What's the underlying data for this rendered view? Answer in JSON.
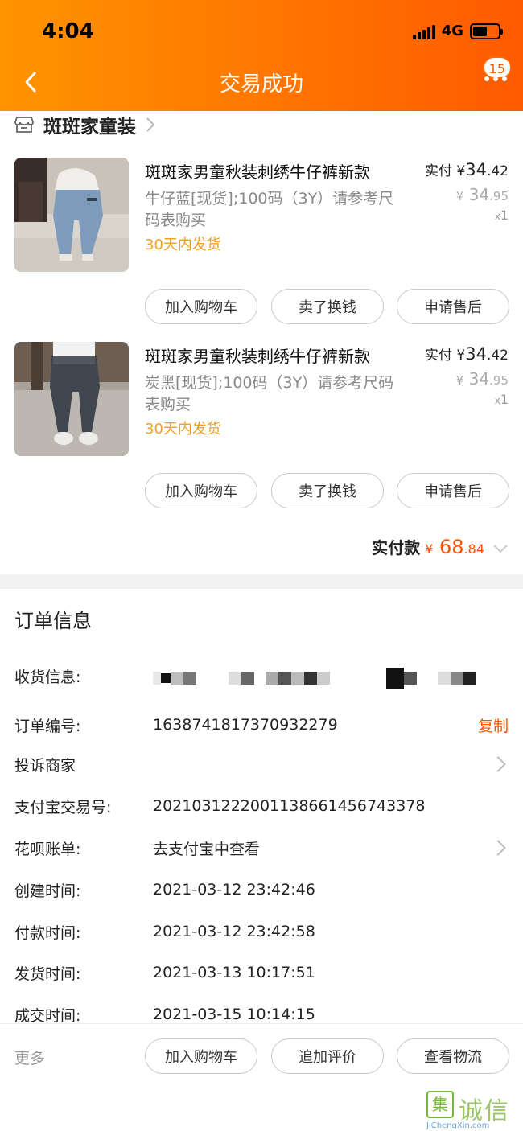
{
  "status_bar": {
    "time": "4:04",
    "network": "4G"
  },
  "nav": {
    "title": "交易成功",
    "badge": "15"
  },
  "shop": {
    "name": "斑斑家童装"
  },
  "products": [
    {
      "title": "斑斑家男童秋装刺绣牛仔裤新款",
      "spec": "牛仔蓝[现货];100码（3Y）请参考尺码表购买",
      "ship": "30天内发货",
      "paid_label": "实付",
      "paid_currency": "¥",
      "paid_int": "34",
      "paid_dec": ".42",
      "orig_currency": "¥",
      "orig_int": "34",
      "orig_dec": ".95",
      "qty_prefix": "x",
      "qty": "1",
      "buttons": [
        "加入购物车",
        "卖了换钱",
        "申请售后"
      ]
    },
    {
      "title": "斑斑家男童秋装刺绣牛仔裤新款",
      "spec": "炭黑[现货];100码（3Y）请参考尺码表购买",
      "ship": "30天内发货",
      "paid_label": "实付",
      "paid_currency": "¥",
      "paid_int": "34",
      "paid_dec": ".42",
      "orig_currency": "¥",
      "orig_int": "34",
      "orig_dec": ".95",
      "qty_prefix": "x",
      "qty": "1",
      "buttons": [
        "加入购物车",
        "卖了换钱",
        "申请售后"
      ]
    }
  ],
  "total": {
    "label": "实付款",
    "currency": "¥",
    "int": "68",
    "dec": ".84"
  },
  "order_info": {
    "title": "订单信息",
    "rows": [
      {
        "key": "收货信息:",
        "value": ""
      },
      {
        "key": "订单编号:",
        "value": "1638741817370932279",
        "action": "复制"
      },
      {
        "key": "投诉商家",
        "value": ""
      },
      {
        "key": "支付宝交易号:",
        "value": "2021031222001138661456743378"
      },
      {
        "key": "花呗账单:",
        "value": "去支付宝中查看"
      },
      {
        "key": "创建时间:",
        "value": "2021-03-12 23:42:46"
      },
      {
        "key": "付款时间:",
        "value": "2021-03-12 23:42:58"
      },
      {
        "key": "发货时间:",
        "value": "2021-03-13 10:17:51"
      },
      {
        "key": "成交时间:",
        "value": "2021-03-15 10:14:15"
      }
    ]
  },
  "bottom_bar": {
    "more": "更多",
    "buttons": [
      "加入购物车",
      "追加评价",
      "查看物流"
    ]
  },
  "watermark": {
    "logo": "集",
    "text": "诚信",
    "url": "JiChengXin.com"
  },
  "colors": {
    "header_start": "#ff9400",
    "header_end": "#ff5a00",
    "price": "#ff5000",
    "ship": "#f0a020"
  }
}
